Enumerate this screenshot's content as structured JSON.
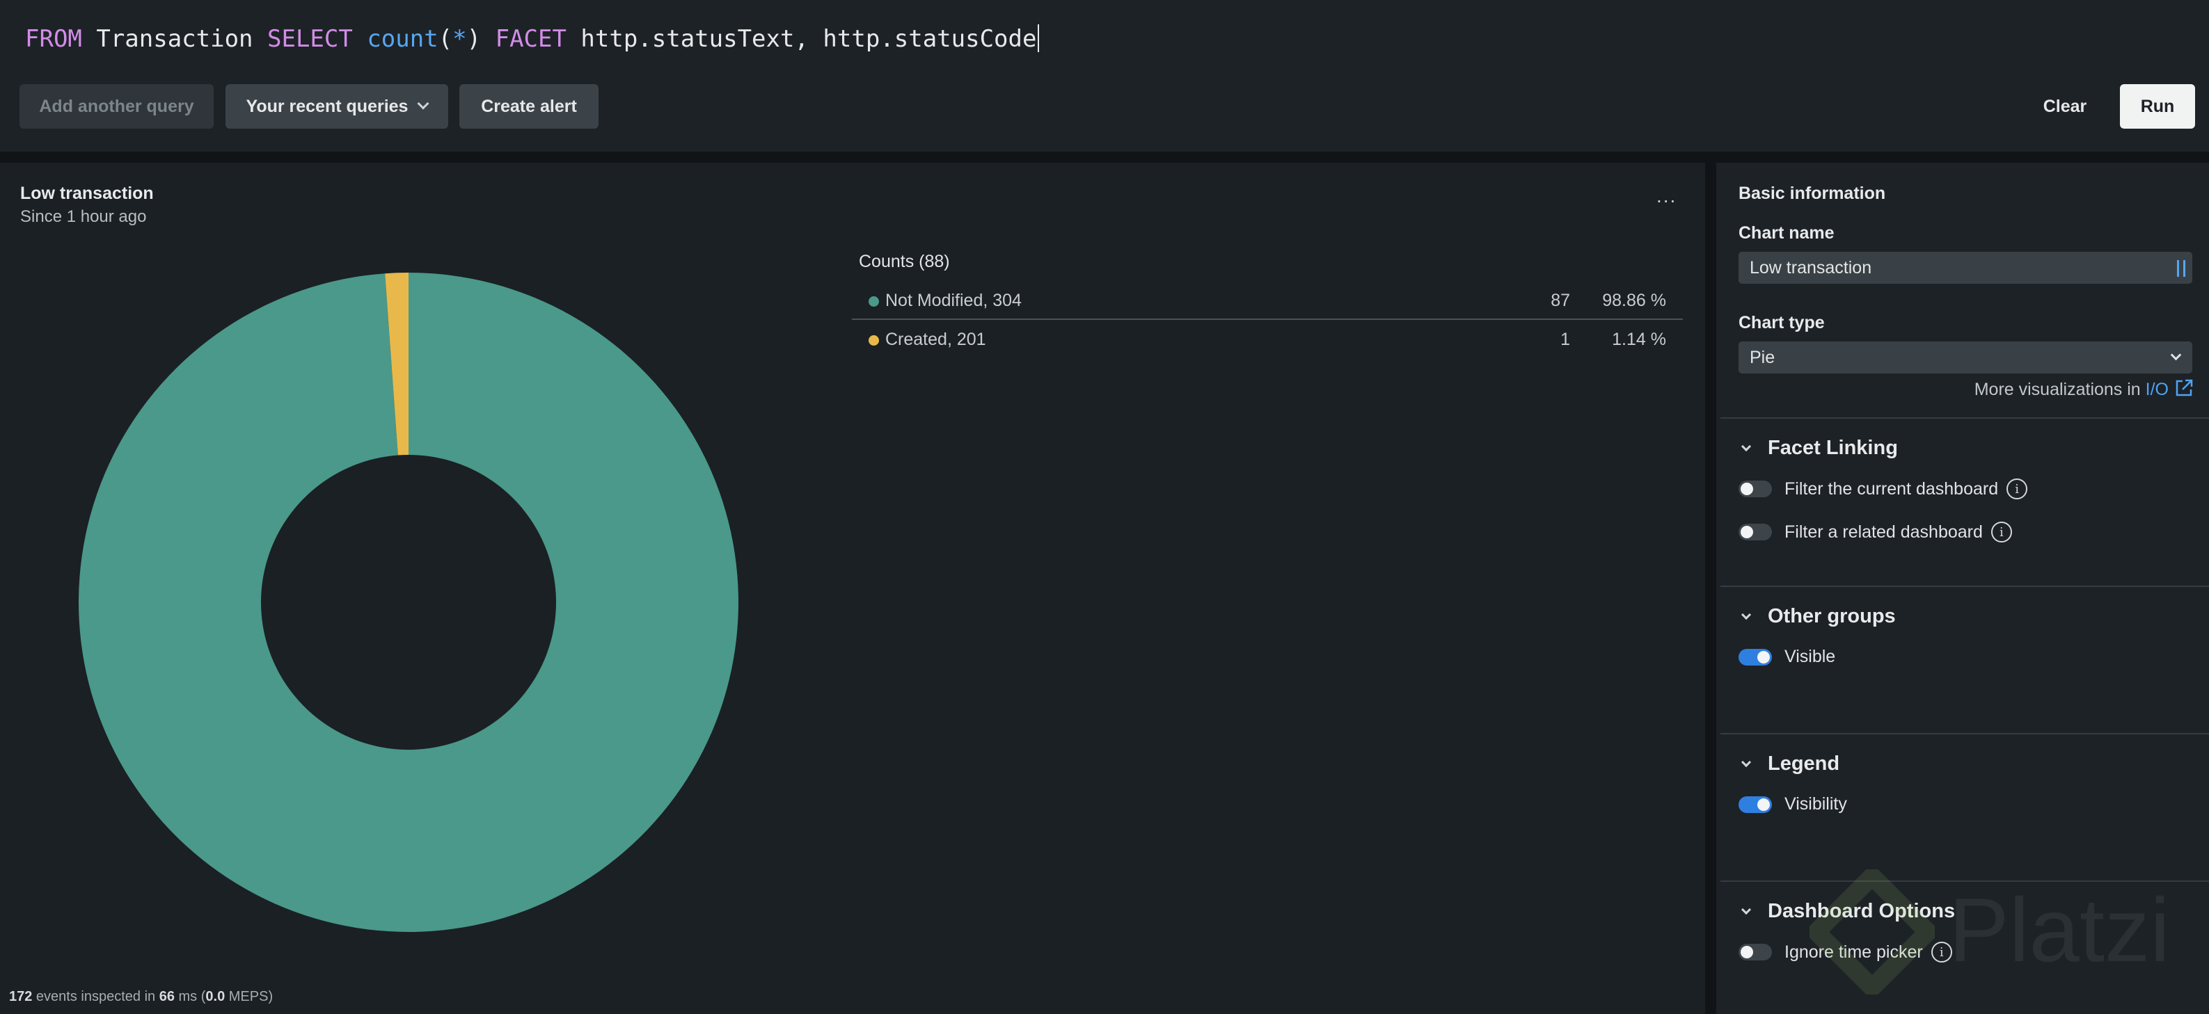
{
  "query": {
    "tokens": [
      {
        "text": "FROM",
        "kind": "kw"
      },
      {
        "text": " Transaction ",
        "kind": "plain"
      },
      {
        "text": "SELECT",
        "kind": "kw"
      },
      {
        "text": " ",
        "kind": "plain"
      },
      {
        "text": "count",
        "kind": "fn"
      },
      {
        "text": "(",
        "kind": "plain"
      },
      {
        "text": "*",
        "kind": "op"
      },
      {
        "text": ") ",
        "kind": "plain"
      },
      {
        "text": "FACET",
        "kind": "kw"
      },
      {
        "text": " http.statusText, http.statusCode",
        "kind": "plain"
      }
    ]
  },
  "toolbar": {
    "add_query_label": "Add another query",
    "recent_queries_label": "Your recent queries",
    "create_alert_label": "Create alert",
    "clear_label": "Clear",
    "run_label": "Run"
  },
  "chart": {
    "title": "Low transaction",
    "subtitle": "Since 1 hour ago",
    "menu_label": "..."
  },
  "chart_data": {
    "type": "pie",
    "variant": "donut",
    "slices": [
      {
        "label": "Not Modified, 304",
        "value": 87,
        "percent": "98.86 %",
        "color": "#4a998a"
      },
      {
        "label": "Created, 201",
        "value": 1,
        "percent": "1.14 %",
        "color": "#e8b94a"
      }
    ],
    "legend_title": "Counts (88)"
  },
  "footer": {
    "events": "172",
    "events_suffix": " events inspected in ",
    "ms": "66",
    "ms_suffix": " ms (",
    "meps": "0.0",
    "meps_suffix": " MEPS)"
  },
  "config": {
    "basic_info_label": "Basic information",
    "chart_name_label": "Chart name",
    "chart_name_value": "Low transaction",
    "chart_type_label": "Chart type",
    "chart_type_value": "Pie",
    "more_viz_text": "More visualizations in ",
    "more_viz_link": "I/O",
    "sections": {
      "facet_linking": {
        "title": "Facet Linking",
        "filter_current": "Filter the current dashboard",
        "filter_related": "Filter a related dashboard"
      },
      "other_groups": {
        "title": "Other groups",
        "visible": "Visible"
      },
      "legend": {
        "title": "Legend",
        "visibility": "Visibility"
      },
      "dashboard_options": {
        "title": "Dashboard Options",
        "ignore_time_picker": "Ignore time picker"
      }
    }
  },
  "watermark": {
    "text": "Platzi"
  },
  "colors": {
    "accent": "#2f7fe0",
    "link": "#4fa3f5",
    "series_1": "#4a998a",
    "series_2": "#e8b94a"
  }
}
